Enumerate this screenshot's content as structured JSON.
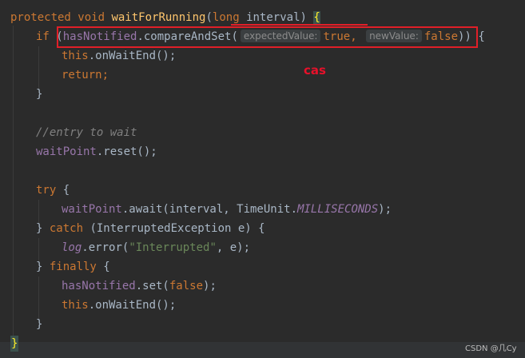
{
  "code": {
    "line1": {
      "kw1": "protected",
      "kw2": "void",
      "method": "waitForRunning",
      "paren_open": "(",
      "type": "long",
      "param": "interval",
      "paren_close": ")",
      "brace": "{"
    },
    "line2": {
      "kw": "if",
      "pre": "(",
      "field": "hasNotified",
      "call": ".compareAndSet(",
      "hint1": "expectedValue:",
      "val1": "true",
      "comma": ",",
      "hint2": "newValue:",
      "val2": "false",
      "post": ")) {"
    },
    "line3": {
      "this": "this",
      "rest": ".onWaitEnd();"
    },
    "line4": {
      "kw": "return",
      "semi": ";"
    },
    "line5": {
      "text": "}"
    },
    "line6": {
      "comment": "//entry to wait"
    },
    "line7": {
      "field": "waitPoint",
      "rest": ".reset();"
    },
    "line8": {
      "kw": "try",
      "rest": " {"
    },
    "line9": {
      "field": "waitPoint",
      "call": ".await(interval, TimeUnit.",
      "const": "MILLISECONDS",
      "end": ");"
    },
    "line10": {
      "brace": "} ",
      "kw": "catch",
      "rest": " (InterruptedException e) {"
    },
    "line11": {
      "field": "log",
      "call": ".error(",
      "str": "\"Interrupted\"",
      "end": ", e);"
    },
    "line12": {
      "brace": "} ",
      "kw": "finally",
      "rest": " {"
    },
    "line13": {
      "field": "hasNotified",
      "call": ".set(",
      "kw": "false",
      "end": ");"
    },
    "line14": {
      "this": "this",
      "rest": ".onWaitEnd();"
    },
    "line15": {
      "text": "}"
    },
    "line16": {
      "text": "}"
    }
  },
  "annotation": {
    "label": "cas",
    "color": "#e01f28"
  },
  "watermark": {
    "csdn": "CSDN @几Cy"
  },
  "colors": {
    "background": "#2b2b2b",
    "keyword": "#cc7832",
    "method": "#ffc66d",
    "field": "#9876aa",
    "text": "#a9b7c6",
    "comment": "#808080",
    "string": "#6a8759"
  }
}
